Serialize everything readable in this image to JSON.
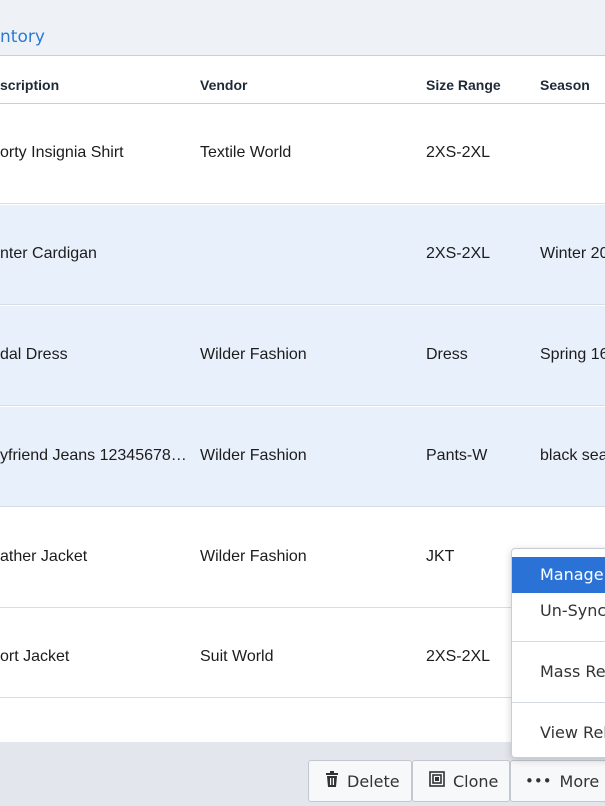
{
  "breadcrumb": "ntory",
  "table": {
    "headers": {
      "description": "scription",
      "vendor": "Vendor",
      "size_range": "Size Range",
      "season": "Season"
    },
    "rows": [
      {
        "description": "orty Insignia Shirt",
        "vendor": "Textile World",
        "size_range": "2XS-2XL",
        "season": ""
      },
      {
        "description": "nter Cardigan",
        "vendor": "",
        "size_range": "2XS-2XL",
        "season": "Winter 20"
      },
      {
        "description": "dal Dress",
        "vendor": "Wilder Fashion",
        "size_range": "Dress",
        "season": "Spring 16"
      },
      {
        "description": "yfriend Jeans 12345678…",
        "vendor": "Wilder Fashion",
        "size_range": "Pants-W",
        "season": "black sea"
      },
      {
        "description": "ather Jacket",
        "vendor": "Wilder Fashion",
        "size_range": "JKT",
        "season": ""
      },
      {
        "description": "ort Jacket",
        "vendor": "Suit World",
        "size_range": "2XS-2XL",
        "season": ""
      }
    ]
  },
  "actions": {
    "delete_label": "Delete",
    "clone_label": "Clone",
    "more_label": "More"
  },
  "more_menu": {
    "items": [
      "Manage S",
      "Un-Sync ",
      "Mass Rep",
      "View Rela"
    ]
  },
  "icons": {
    "delete": "trash-icon",
    "clone": "clone-icon",
    "more": "ellipsis-icon",
    "caret": "caret-up-icon"
  },
  "colors": {
    "accent": "#2b72d6",
    "selected_row": "#e8f0fb"
  }
}
